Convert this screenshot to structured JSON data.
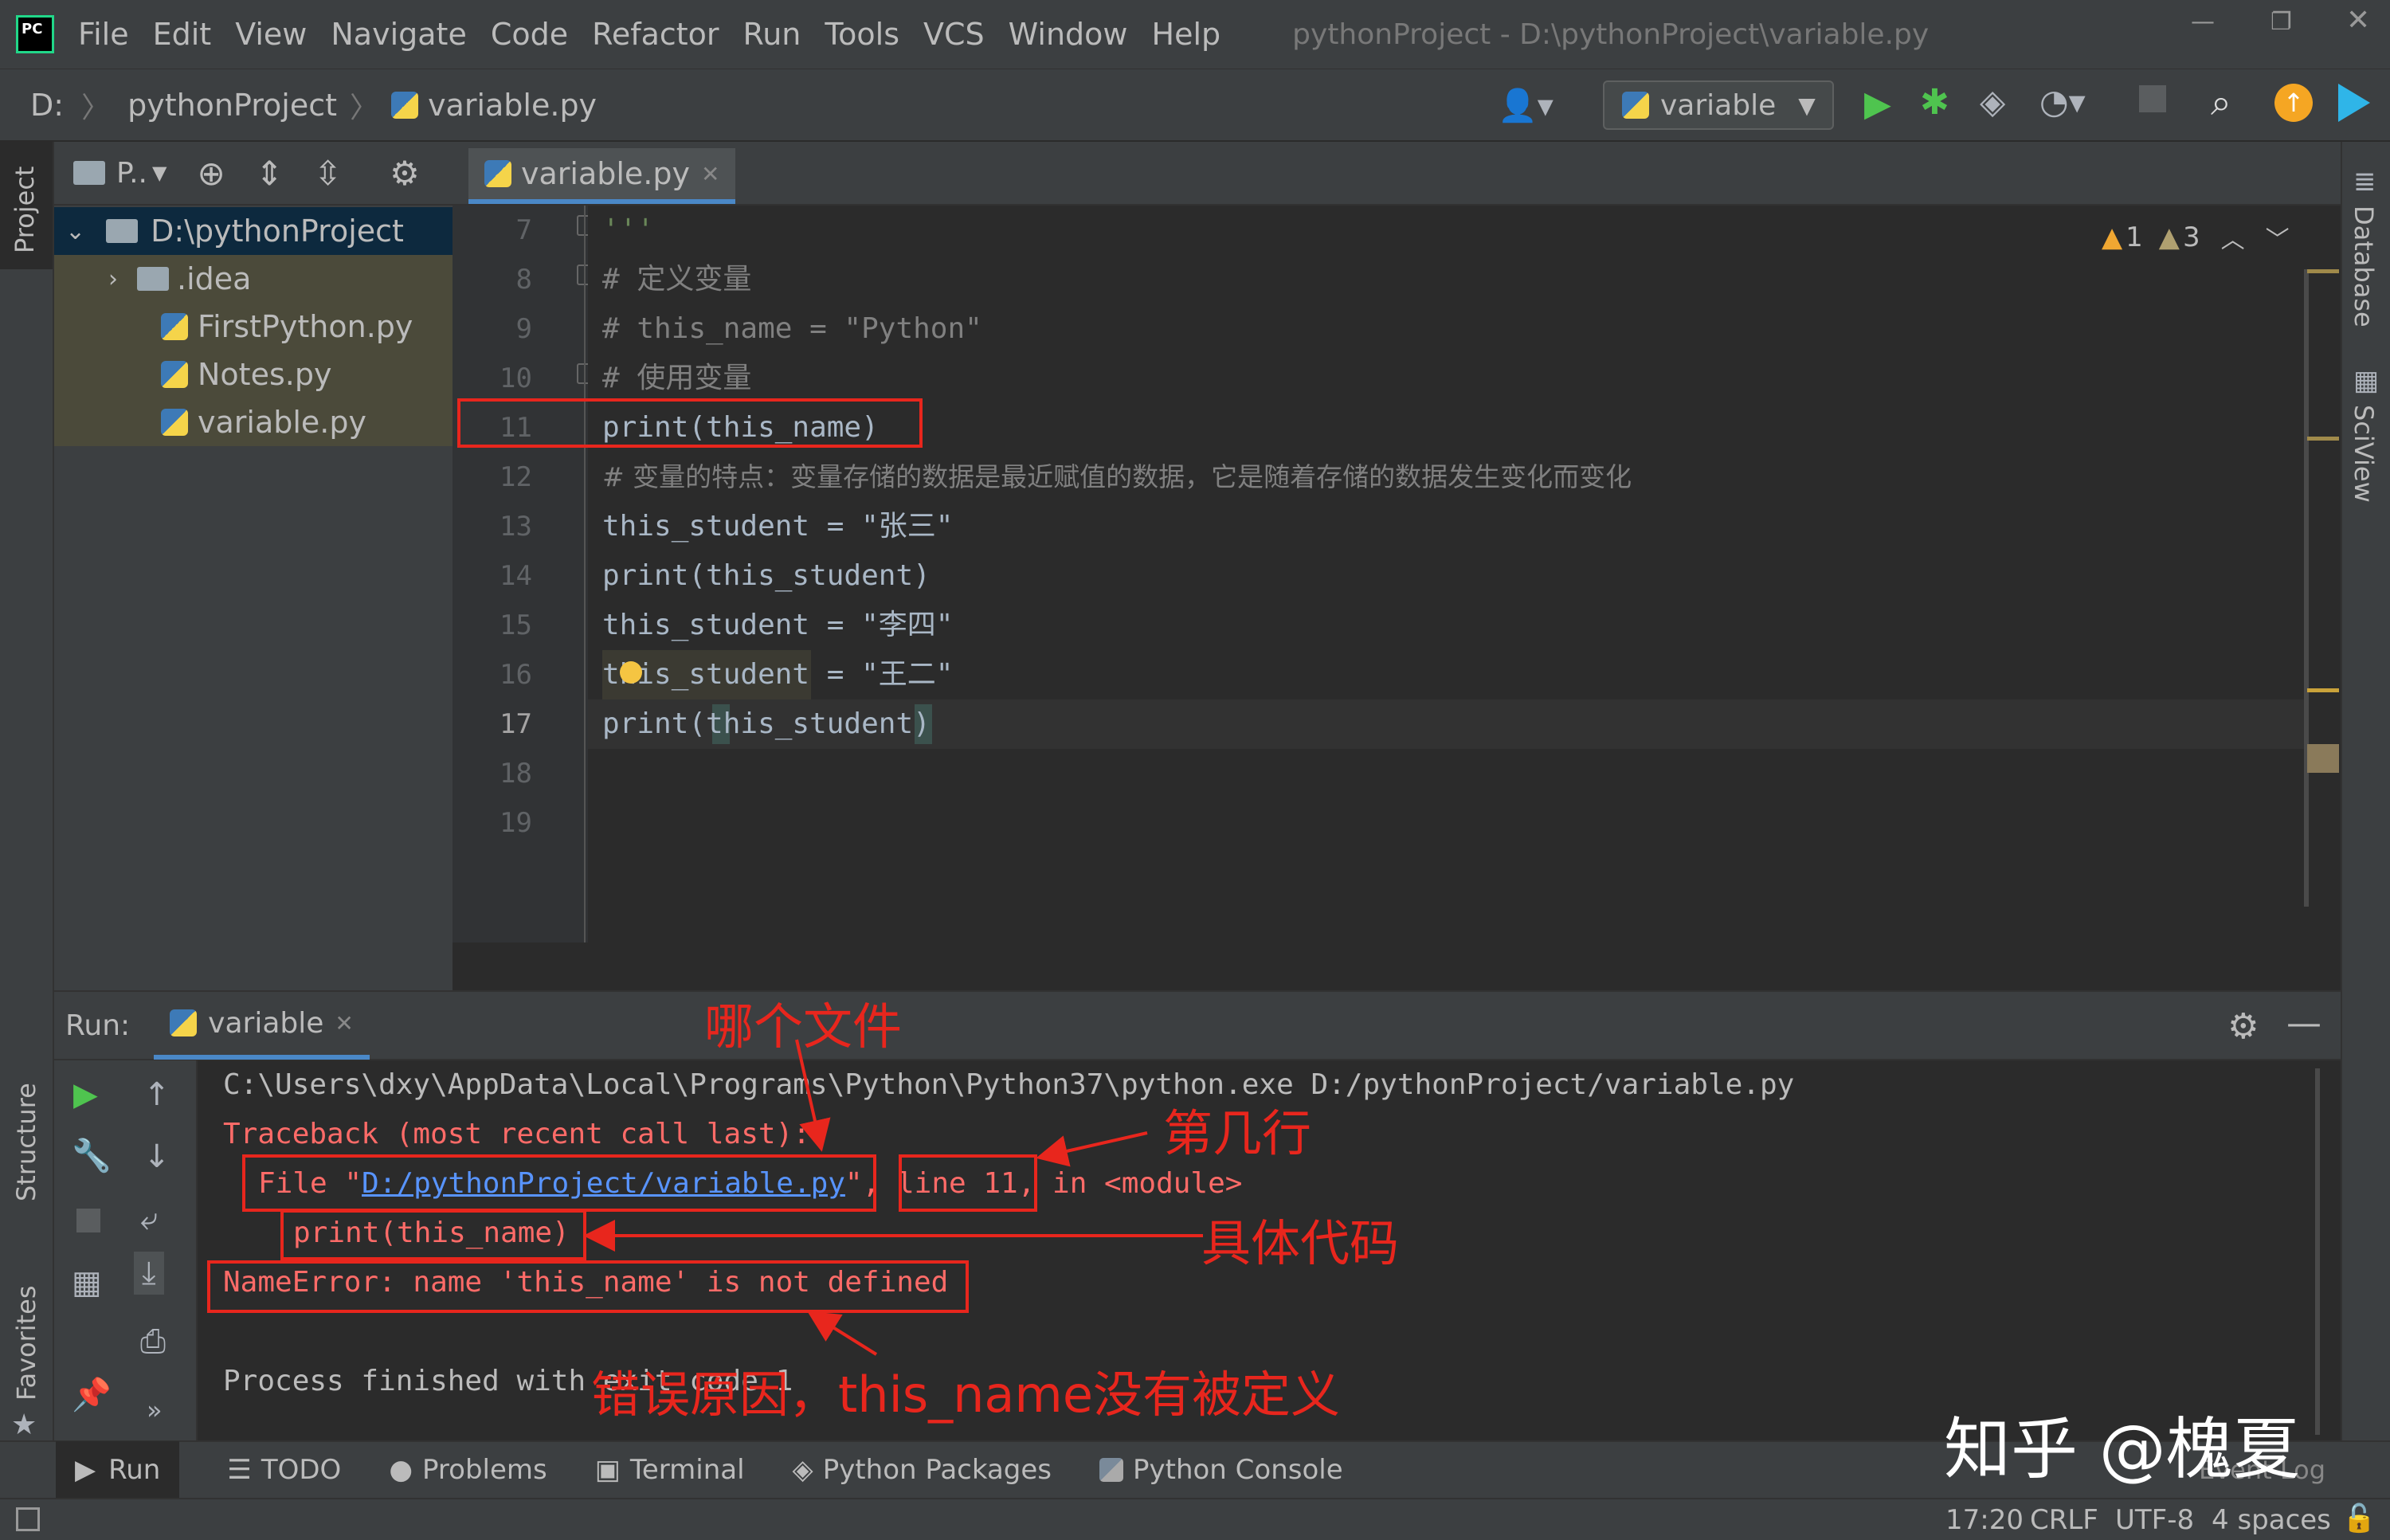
{
  "menubar": {
    "logo": "PC",
    "items": [
      "File",
      "Edit",
      "View",
      "Navigate",
      "Code",
      "Refactor",
      "Run",
      "Tools",
      "VCS",
      "Window",
      "Help"
    ],
    "title": "pythonProject - D:\\pythonProject\\variable.py"
  },
  "navbar": {
    "crumbs": [
      "D:",
      "pythonProject",
      "variable.py"
    ],
    "run_config": "variable"
  },
  "left_strip": {
    "top": "Project",
    "structure": "Structure",
    "favorites": "Favorites"
  },
  "right_strip": {
    "database": "Database",
    "sciview": "SciView"
  },
  "project": {
    "view_label": "P..",
    "tree": [
      {
        "label": "D:\\pythonProject",
        "type": "folder-open"
      },
      {
        "label": ".idea",
        "type": "folder"
      },
      {
        "label": "FirstPython.py",
        "type": "py"
      },
      {
        "label": "Notes.py",
        "type": "py"
      },
      {
        "label": "variable.py",
        "type": "py"
      }
    ]
  },
  "editor": {
    "tab": "variable.py",
    "warnings": {
      "a": "1",
      "b": "3"
    },
    "lines": [
      {
        "n": "7",
        "text": "'''"
      },
      {
        "n": "8",
        "text": "# 定义变量"
      },
      {
        "n": "9",
        "text": "# this_name = \"Python\""
      },
      {
        "n": "10",
        "text": "# 使用变量"
      },
      {
        "n": "11",
        "text": "print(this_name)"
      },
      {
        "n": "12",
        "text": "# 变量的特点：变量存储的数据是最近赋值的数据，它是随着存储的数据发生变化而变化"
      },
      {
        "n": "13",
        "text": "this_student = \"张三\""
      },
      {
        "n": "14",
        "text": "print(this_student)"
      },
      {
        "n": "15",
        "text": "this_student = \"李四\""
      },
      {
        "n": "16",
        "text": "this_student = \"王二\""
      },
      {
        "n": "17",
        "text": "print(this_student)"
      },
      {
        "n": "18",
        "text": ""
      },
      {
        "n": "19",
        "text": ""
      }
    ]
  },
  "run": {
    "label": "Run:",
    "tab": "variable",
    "console": {
      "cmd": "C:\\Users\\dxy\\AppData\\Local\\Programs\\Python\\Python37\\python.exe D:/pythonProject/variable.py",
      "traceback": "Traceback (most recent call last):",
      "file_prefix": "File \"",
      "file_link": "D:/pythonProject/variable.py",
      "file_suffix": "\",",
      "line_info": "line 11",
      "module_info": ", in <module>",
      "code": "print(this_name)",
      "error": "NameError: name 'this_name' is not defined",
      "finished": "Process finished with exit code 1"
    }
  },
  "annotations": {
    "file": "哪个文件",
    "line": "第几行",
    "code": "具体代码",
    "reason": "错误原因，this_name没有被定义"
  },
  "bottom_tabs": [
    "Run",
    "TODO",
    "Problems",
    "Terminal",
    "Python Packages",
    "Python Console"
  ],
  "watermark": "知乎 @槐夏",
  "event_log": "Event Log",
  "status": {
    "pos": "17:20",
    "eol": "CRLF",
    "enc": "UTF-8",
    "indent": "4 spaces"
  }
}
